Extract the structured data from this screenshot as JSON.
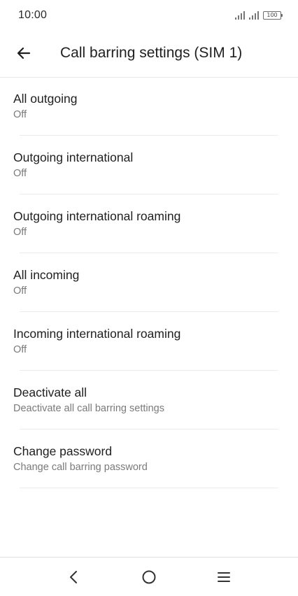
{
  "status_bar": {
    "time": "10:00",
    "battery": "100",
    "icons": [
      "signal-sim1-icon",
      "signal-sim2-icon",
      "battery-icon"
    ]
  },
  "app_bar": {
    "title": "Call barring settings (SIM 1)",
    "back_icon": "arrow-left-icon"
  },
  "settings": [
    {
      "title": "All outgoing",
      "summary": "Off"
    },
    {
      "title": "Outgoing international",
      "summary": "Off"
    },
    {
      "title": "Outgoing international roaming",
      "summary": "Off"
    },
    {
      "title": "All incoming",
      "summary": "Off"
    },
    {
      "title": "Incoming international roaming",
      "summary": "Off"
    },
    {
      "title": "Deactivate all",
      "summary": "Deactivate all call barring settings"
    },
    {
      "title": "Change password",
      "summary": "Change call barring password"
    }
  ],
  "nav_bar": {
    "icons": [
      "back-chevron-icon",
      "home-circle-icon",
      "menu-lines-icon"
    ]
  },
  "colors": {
    "text_primary": "#1f1f1f",
    "text_secondary": "#7a7a7a",
    "divider": "#ececec",
    "background": "#ffffff"
  }
}
